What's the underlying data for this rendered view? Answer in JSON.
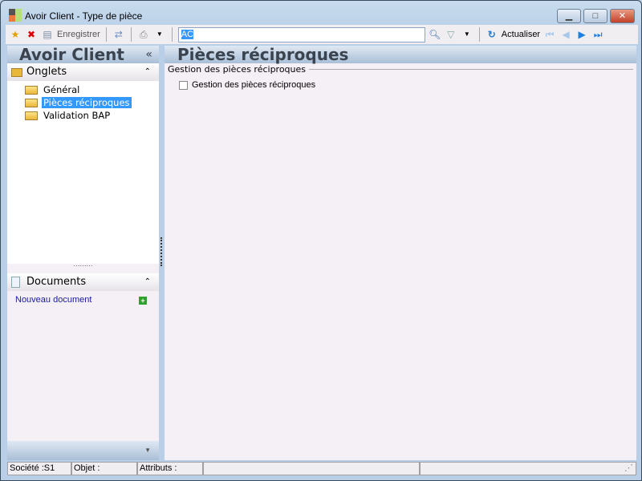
{
  "window": {
    "title": "Avoir Client -  Type de pièce",
    "minimize": "▁",
    "restore": "□",
    "close": "✕"
  },
  "toolbar": {
    "save_label": "Enregistrer",
    "search_value": "AC",
    "refresh_label": "Actualiser"
  },
  "sidebar": {
    "title": "Avoir Client",
    "collapse": "«",
    "onglets_label": "Onglets",
    "tabs": [
      {
        "label": "Général"
      },
      {
        "label": "Pièces réciproques"
      },
      {
        "label": "Validation BAP"
      }
    ],
    "documents_label": "Documents",
    "new_document": "Nouveau document"
  },
  "main": {
    "title": "Pièces réciproques",
    "group_label": "Gestion des pièces réciproques",
    "checkbox_label": "Gestion des pièces réciproques",
    "checkbox_checked": false
  },
  "status": {
    "societe": "Société :S1",
    "objet": "Objet :",
    "attributs": "Attributs :"
  }
}
